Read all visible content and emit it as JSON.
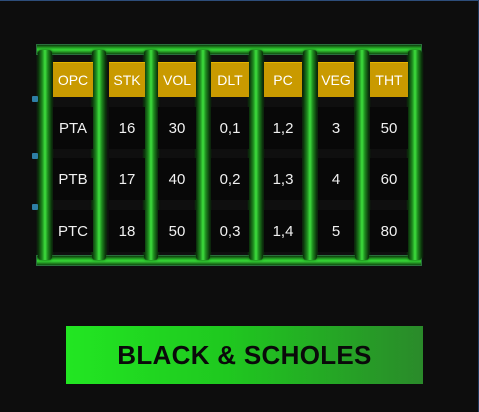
{
  "table": {
    "headers": [
      "OPC",
      "STK",
      "VOL",
      "DLT",
      "PC",
      "VEG",
      "THT"
    ],
    "rows": [
      [
        "PTA",
        "16",
        "30",
        "0,1",
        "1,2",
        "3",
        "50"
      ],
      [
        "PTB",
        "17",
        "40",
        "0,2",
        "1,3",
        "4",
        "60"
      ],
      [
        "PTC",
        "18",
        "50",
        "0,3",
        "1,4",
        "5",
        "80"
      ]
    ]
  },
  "title_button": {
    "label": "BLACK & SCHOLES"
  },
  "colors": {
    "background": "#0d0d0d",
    "header_fill": "#c99a00",
    "frame_green": "#2bbd2b",
    "button_green": "#22e622"
  }
}
